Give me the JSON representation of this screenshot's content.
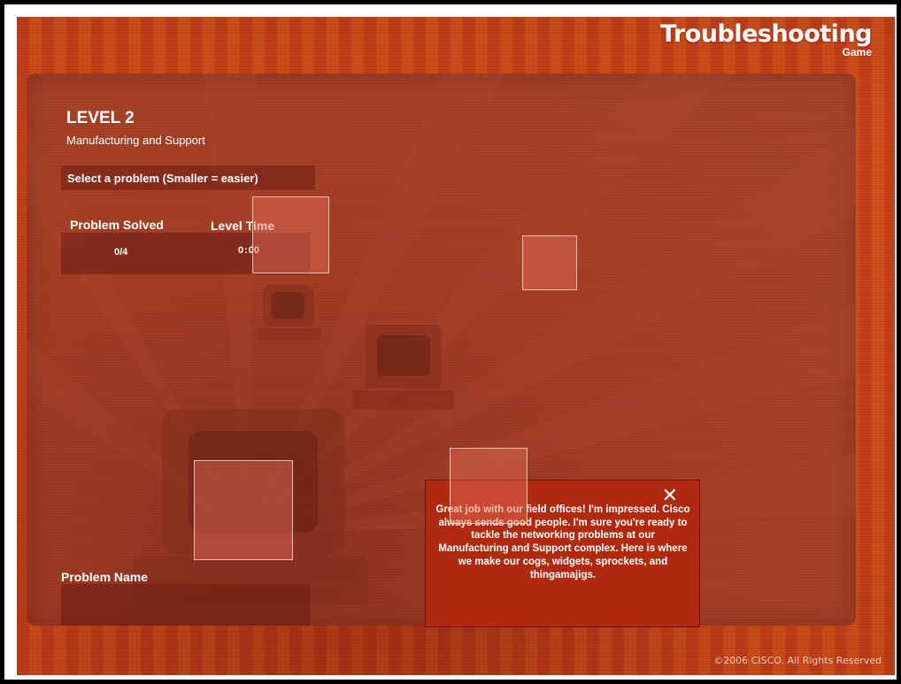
{
  "title": {
    "main": "Troubleshooting",
    "sub": "Game"
  },
  "level": {
    "title": "LEVEL 2",
    "subtitle": "Manufacturing and Support"
  },
  "select_prompt": "Select a problem (Smaller = easier)",
  "stats": {
    "problem_solved_label": "Problem Solved",
    "problem_solved_value": "0/4",
    "level_time_label": "Level Time",
    "level_time_minutes": "0",
    "level_time_separator": ":",
    "level_time_seconds": "00"
  },
  "problem_name_label": "Problem Name",
  "dialog": {
    "close_icon": "close-icon",
    "message": "Great job with our field offices!  I'm impressed.  Cisco always sends good people.  I'm sure you're ready to tackle the networking problems at our Manufacturing and Support complex.  Here is where we make our cogs, widgets, sprockets, and thingamajigs."
  },
  "copyright": "©2006 CISCO. All Rights Reserved",
  "colors": {
    "background_orange": "#c8401a",
    "dialog_red": "#b02a10",
    "panel_red": "#a33d24"
  }
}
